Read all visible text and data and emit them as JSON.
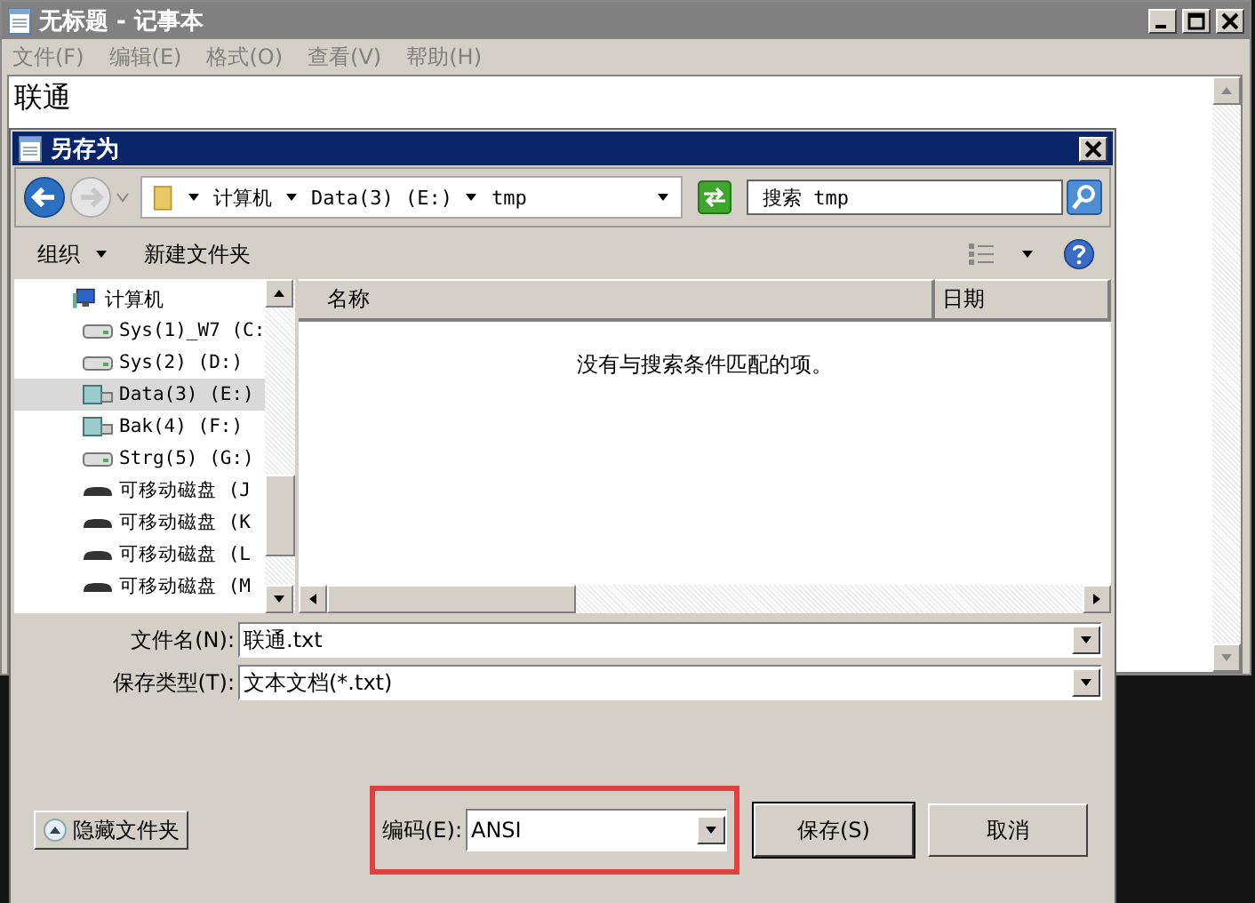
{
  "notepad": {
    "title": "无标题 - 记事本",
    "menu": [
      "文件(F)",
      "编辑(E)",
      "格式(O)",
      "查看(V)",
      "帮助(H)"
    ],
    "text": "联通"
  },
  "dialog": {
    "title": "另存为",
    "address": [
      "计算机",
      "Data(3) (E:)",
      "tmp"
    ],
    "search": {
      "placeholder": "搜索 tmp"
    },
    "toolbar": {
      "organize": "组织",
      "new_folder": "新建文件夹"
    },
    "tree": [
      {
        "label": "计算机",
        "kind": "computer",
        "selected": false,
        "children": [
          {
            "label": "Sys(1)_W7 (C:",
            "kind": "disk",
            "selected": false
          },
          {
            "label": "Sys(2) (D:)",
            "kind": "disk",
            "selected": false
          },
          {
            "label": "Data(3) (E:)",
            "kind": "shared",
            "selected": true
          },
          {
            "label": "Bak(4) (F:)",
            "kind": "shared",
            "selected": false
          },
          {
            "label": "Strg(5) (G:)",
            "kind": "disk",
            "selected": false
          },
          {
            "label": "可移动磁盘 (J",
            "kind": "removable",
            "selected": false
          },
          {
            "label": "可移动磁盘 (K",
            "kind": "removable",
            "selected": false
          },
          {
            "label": "可移动磁盘 (L",
            "kind": "removable",
            "selected": false
          },
          {
            "label": "可移动磁盘 (M",
            "kind": "removable",
            "selected": false
          }
        ]
      }
    ],
    "columns": [
      "名称",
      "日期"
    ],
    "empty_message": "没有与搜索条件匹配的项。",
    "filename": {
      "label": "文件名(N):",
      "value": "联通.txt"
    },
    "filetype": {
      "label": "保存类型(T):",
      "value": "文本文档(*.txt)"
    },
    "hide_folders": "隐藏文件夹",
    "encoding": {
      "label": "编码(E):",
      "value": "ANSI",
      "highlighted": true
    },
    "buttons": [
      "保存(S)",
      "取消"
    ]
  }
}
